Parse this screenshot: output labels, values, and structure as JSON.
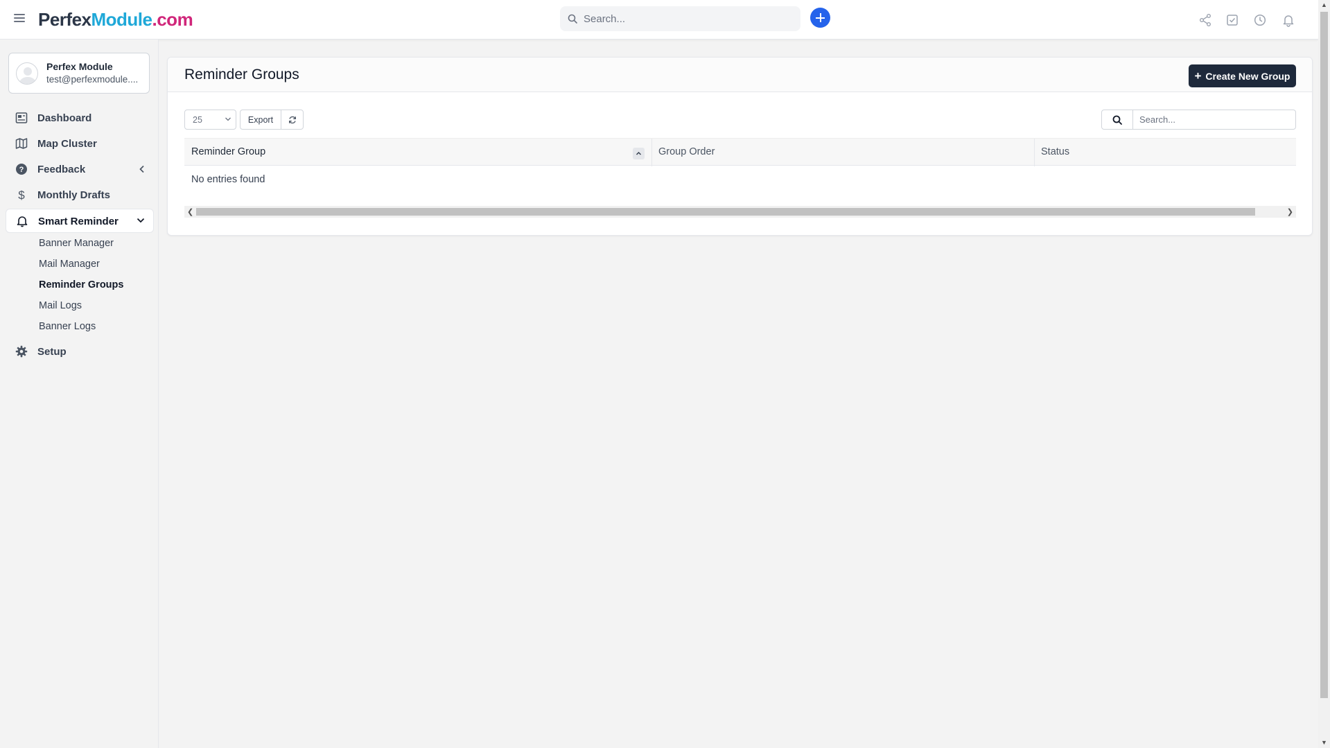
{
  "header": {
    "logo": {
      "part1": "Perfex",
      "part2": "Module",
      "part3": ".com"
    },
    "search_placeholder": "Search...",
    "icons": [
      "share-icon",
      "checkbox-icon",
      "clock-icon",
      "bell-icon"
    ],
    "accent_color": "#2563eb"
  },
  "profile": {
    "name": "Perfex Module",
    "email": "test@perfexmodule...."
  },
  "sidebar": {
    "items": [
      {
        "label": "Dashboard",
        "icon": "dashboard-icon"
      },
      {
        "label": "Map Cluster",
        "icon": "map-icon"
      },
      {
        "label": "Feedback",
        "icon": "question-circle-icon"
      },
      {
        "label": "Monthly Drafts",
        "icon": "dollar-icon"
      },
      {
        "label": "Smart Reminder",
        "icon": "bell-icon"
      },
      {
        "label": "Setup",
        "icon": "gear-icon"
      }
    ],
    "submenu": [
      {
        "label": "Banner Manager"
      },
      {
        "label": "Mail Manager"
      },
      {
        "label": "Reminder Groups"
      },
      {
        "label": "Mail Logs"
      },
      {
        "label": "Banner Logs"
      }
    ],
    "active_item": "Smart Reminder",
    "current_submenu": "Reminder Groups"
  },
  "main": {
    "title": "Reminder Groups",
    "create_button": "Create New Group",
    "create_button_plus": "+",
    "page_length": "25",
    "export_label": "Export",
    "table_search_placeholder": "Search...",
    "columns": [
      "Reminder Group",
      "Group Order",
      "Status"
    ],
    "empty_message": "No entries found"
  }
}
